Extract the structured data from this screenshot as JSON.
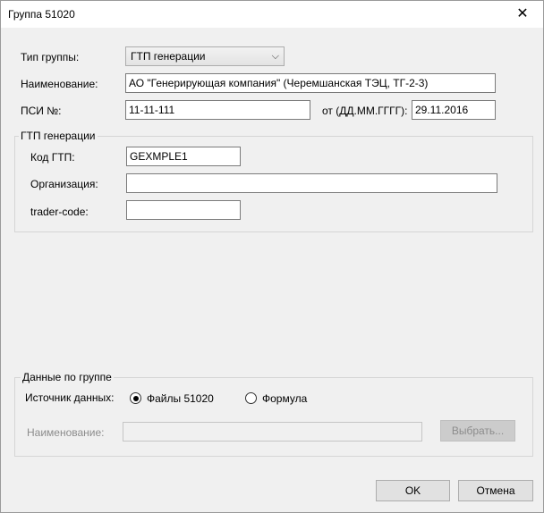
{
  "window": {
    "title": "Группа 51020",
    "close_icon": "close-icon"
  },
  "form": {
    "group_type_label": "Тип группы:",
    "group_type_value": "ГТП генерации",
    "name_label": "Наименование:",
    "name_value": "АО \"Генерирующая компания\" (Черемшанская ТЭЦ, ТГ-2-3)",
    "psi_label": "ПСИ №:",
    "psi_value": "11-11-111",
    "date_label": "от (ДД.ММ.ГГГГ):",
    "date_value": "29.11.2016"
  },
  "gtp_group": {
    "caption": "ГТП генерации",
    "code_label": "Код ГТП:",
    "code_value": "GEXMPLE1",
    "org_label": "Организация:",
    "org_value": "",
    "trader_label": "trader-code:",
    "trader_value": ""
  },
  "data_group": {
    "caption": "Данные по группе",
    "source_label": "Источник данных:",
    "source_options": [
      {
        "label": "Файлы 51020",
        "checked": true
      },
      {
        "label": "Формула",
        "checked": false
      }
    ],
    "name_label": "Наименование:",
    "name_value": "",
    "choose_button": "Выбрать..."
  },
  "buttons": {
    "ok": "OK",
    "cancel": "Отмена"
  }
}
